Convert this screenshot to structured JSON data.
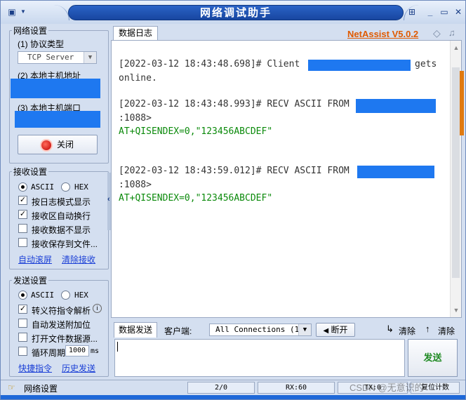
{
  "window": {
    "title": "网络调试助手"
  },
  "brand": {
    "name": "NetAssist V5.0.2",
    "color": "#e05a00"
  },
  "network": {
    "group_title": "网络设置",
    "protocol_label": "(1) 协议类型",
    "protocol_value": "TCP Server",
    "host_label": "(2) 本地主机地址",
    "port_label": "(3) 本地主机端口",
    "close_button": "关闭",
    "status_icon": "red-led-icon"
  },
  "receive": {
    "group_title": "接收设置",
    "ascii": "ASCII",
    "hex": "HEX",
    "encoding_selected": "ASCII",
    "options": [
      {
        "label": "按日志模式显示",
        "checked": true
      },
      {
        "label": "接收区自动换行",
        "checked": true
      },
      {
        "label": "接收数据不显示",
        "checked": false
      },
      {
        "label": "接收保存到文件...",
        "checked": false
      }
    ],
    "link_autoscroll": "自动滚屏",
    "link_clear": "清除接收"
  },
  "send": {
    "group_title": "发送设置",
    "ascii": "ASCII",
    "hex": "HEX",
    "encoding_selected": "ASCII",
    "options": [
      {
        "label": "转义符指令解析",
        "checked": true
      },
      {
        "label": "自动发送附加位",
        "checked": false
      },
      {
        "label": "打开文件数据源...",
        "checked": false
      },
      {
        "label": "循环周期",
        "checked": false
      }
    ],
    "cycle_value": "1000",
    "cycle_unit": "ms",
    "link_shortcuts": "快捷指令",
    "link_history": "历史发送"
  },
  "log": {
    "tab_label": "数据日志",
    "entries": [
      {
        "line1": "[2022-03-12 18:43:48.698]# Client",
        "line1_tail": "gets",
        "line2": "online."
      },
      {
        "line1": "[2022-03-12 18:43:48.993]# RECV ASCII FROM",
        "line2": ":1088>",
        "data": "AT+QISENDEX=0,\"123456ABCDEF\""
      },
      {
        "line1": "[2022-03-12 18:43:59.012]# RECV ASCII FROM",
        "line2": ":1088>",
        "data": "AT+QISENDEX=0,\"123456ABCDEF\""
      }
    ]
  },
  "sendbar": {
    "tab_label": "数据发送",
    "client_label": "客户端:",
    "connections_value": "All Connections (1)",
    "disconnect_button": "断开",
    "clear1_button": "清除",
    "clear2_button": "清除",
    "send_button": "发送"
  },
  "statusbar": {
    "label": "网络设置",
    "count": "2/0",
    "rx": "RX:60",
    "tx": "TX:0",
    "reset": "复位计数"
  },
  "watermark": "CSDN @无意识的"
}
